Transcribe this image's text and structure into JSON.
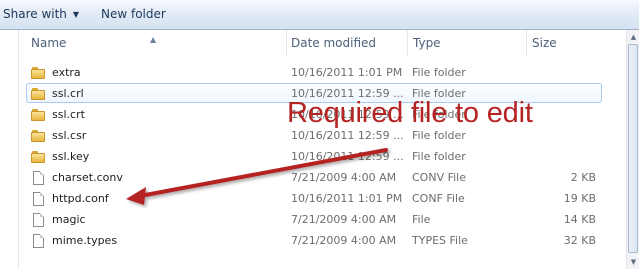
{
  "toolbar": {
    "share_label": "Share with",
    "new_folder_label": "New folder"
  },
  "columns": {
    "name": "Name",
    "date": "Date modified",
    "type": "Type",
    "size": "Size"
  },
  "files": [
    {
      "icon": "folder-icon",
      "name": "extra",
      "date": "10/16/2011 1:01 PM",
      "type": "File folder",
      "size": ""
    },
    {
      "icon": "folder-icon",
      "name": "ssl.crl",
      "date": "10/16/2011 12:59 ...",
      "type": "File folder",
      "size": ""
    },
    {
      "icon": "folder-icon",
      "name": "ssl.crt",
      "date": "10/16/2011 12:59 ...",
      "type": "File folder",
      "size": ""
    },
    {
      "icon": "folder-icon",
      "name": "ssl.csr",
      "date": "10/16/2011 12:59 ...",
      "type": "File folder",
      "size": ""
    },
    {
      "icon": "folder-icon",
      "name": "ssl.key",
      "date": "10/16/2011 12:59 ...",
      "type": "File folder",
      "size": ""
    },
    {
      "icon": "file-icon",
      "name": "charset.conv",
      "date": "7/21/2009 4:00 AM",
      "type": "CONV File",
      "size": "2 KB"
    },
    {
      "icon": "file-icon",
      "name": "httpd.conf",
      "date": "10/16/2011 1:01 PM",
      "type": "CONF File",
      "size": "19 KB"
    },
    {
      "icon": "file-icon",
      "name": "magic",
      "date": "7/21/2009 4:00 AM",
      "type": "File",
      "size": "14 KB"
    },
    {
      "icon": "file-icon",
      "name": "mime.types",
      "date": "7/21/2009 4:00 AM",
      "type": "TYPES File",
      "size": "32 KB"
    }
  ],
  "hovered_row": "ssl.crl",
  "annotation": {
    "text": "Required file to edit",
    "color": "#b52423"
  }
}
